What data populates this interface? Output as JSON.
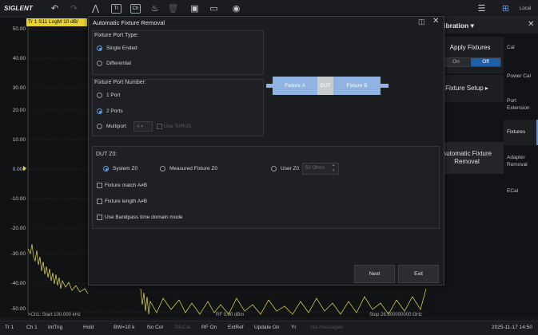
{
  "toolbar": {
    "logo": "SIGLENT",
    "local_label": "Local",
    "icons": [
      "undo-icon",
      "redo-icon",
      "cal-wizard-icon",
      "trace-icon",
      "channel-icon",
      "fixture-icon",
      "delete-icon",
      "save-icon",
      "open-folder-icon",
      "camera-icon",
      "menu-icon",
      "network-icon"
    ]
  },
  "plot": {
    "trace_tag": "Tr 1  S11 LogM 10 dB/",
    "y_labels": [
      "50.00",
      "40.00",
      "30.00",
      "20.00",
      "10.00",
      "0.000",
      "-10.00",
      "-20.00",
      "-30.00",
      "-40.00",
      "-50.00"
    ],
    "start": ">Ch1: Start 100.000 kHz",
    "center": "RF 0.00 dBm",
    "stop": "Stop 26.500000000 GHz"
  },
  "dialog": {
    "title": "Automatic Fixture Removal",
    "port_type": {
      "title": "Fixture Port Type:",
      "options": [
        "Single Ended",
        "Differential"
      ],
      "selected": "Single Ended"
    },
    "port_number": {
      "title": "Fixture Port Number:",
      "options": [
        "1 Port",
        "2 Ports",
        "Multiport"
      ],
      "selected": "2 Ports",
      "multiport_select": "4",
      "use_trl_label": "Use TrlRUS"
    },
    "diagram": {
      "fixture_a": "Fixture A",
      "dut": "DUT",
      "fixture_b": "Fixture B"
    },
    "dut_z0": {
      "title": "DUT Z0:",
      "options": [
        "System Z0",
        "Measured Fixture Z0",
        "User Z0"
      ],
      "selected": "System Z0",
      "user_z0_value": "50 Ohms"
    },
    "checks": [
      "Fixture match A≠B",
      "Fixture length A≠B",
      "Use Bandpass time domain mode"
    ],
    "next_label": "Next",
    "exit_label": "Exit"
  },
  "menu": {
    "title": "alibration",
    "apply_fixtures": "Apply Fixtures",
    "toggle_on": "On",
    "toggle_off": "Off",
    "fixture_setup": "Fixture Setup",
    "auto_fixture_removal": "Automatic Fixture Removal",
    "right_items": [
      "Cal",
      "Power Cal",
      "Port Extension",
      "Fixtures",
      "Adapter Removal",
      "ECal"
    ]
  },
  "status": {
    "items": [
      "Tr 1",
      "Ch 1",
      "IntTrig",
      "Hold",
      "BW=10 k",
      "No Cor",
      "DisCal",
      "RF On",
      "ExtRef",
      "Update On",
      "Yr",
      "No messages"
    ],
    "datetime": "2025-11-17 14:50"
  }
}
